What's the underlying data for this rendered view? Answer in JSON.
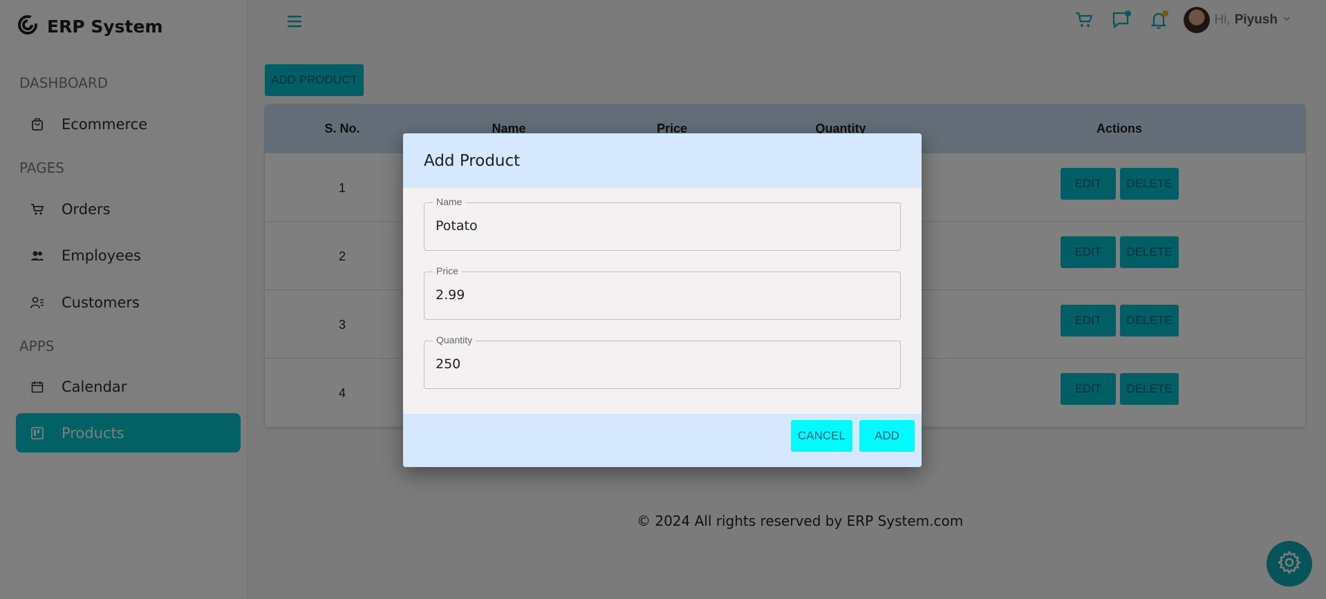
{
  "brand": {
    "name": "ERP System"
  },
  "sidebar": {
    "sections": [
      "DASHBOARD",
      "PAGES",
      "APPS"
    ],
    "items": [
      {
        "label": "Ecommerce",
        "icon": "shopping-bag-icon"
      },
      {
        "label": "Orders",
        "icon": "cart-icon"
      },
      {
        "label": "Employees",
        "icon": "employees-icon"
      },
      {
        "label": "Customers",
        "icon": "customers-icon"
      },
      {
        "label": "Calendar",
        "icon": "calendar-icon"
      },
      {
        "label": "Products",
        "icon": "kanban-icon",
        "active": true
      }
    ]
  },
  "header": {
    "greeting": "Hi,",
    "user_name": "Piyush",
    "icons": [
      "cart-icon",
      "chat-icon",
      "bell-icon"
    ]
  },
  "main": {
    "add_product_label": "ADD PRODUCT",
    "table": {
      "columns": [
        "S. No.",
        "Name",
        "Price",
        "Quantity",
        "Actions"
      ],
      "rows": [
        {
          "no": "1"
        },
        {
          "no": "2"
        },
        {
          "no": "3"
        },
        {
          "no": "4"
        }
      ],
      "edit_label": "EDIT",
      "delete_label": "DELETE"
    }
  },
  "footer": {
    "text": "© 2024 All rights reserved by ERP System.com"
  },
  "dialog": {
    "title": "Add Product",
    "fields": [
      {
        "label": "Name",
        "value": "Potato"
      },
      {
        "label": "Price",
        "value": "2.99"
      },
      {
        "label": "Quantity",
        "value": "250"
      }
    ],
    "cancel_label": "CANCEL",
    "add_label": "ADD"
  },
  "colors": {
    "accent": "#00bfc8",
    "accent_dialog": "#00fbff",
    "header_bg": "#c7dcf3",
    "dialog_header_bg": "#d6e8fd"
  }
}
